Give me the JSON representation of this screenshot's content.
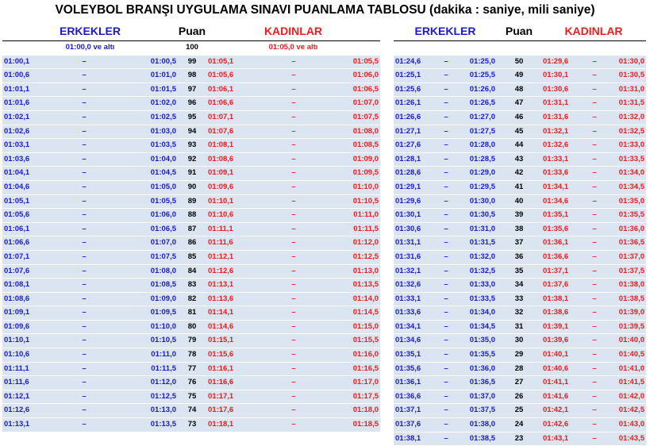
{
  "title": "VOLEYBOL BRANŞI UYGULAMA SINAVI PUANLAMA TABLOSU (dakika : saniye, mili saniye)",
  "headers": {
    "male": "ERKEKLER",
    "points": "Puan",
    "female": "KADINLAR"
  },
  "dash": "–",
  "colors": {
    "male": "#1a1ad6",
    "female": "#ee1c1c",
    "row_stripe": "#dbe5f1"
  },
  "base_row": {
    "male": "01:00,0 ve altı",
    "points": "100",
    "female": "01:05,0 ve altı"
  },
  "left_rows": [
    [
      "01:00,1",
      "01:00,5",
      "99",
      "01:05,1",
      "01:05,5"
    ],
    [
      "01:00,6",
      "01:01,0",
      "98",
      "01:05,6",
      "01:06,0"
    ],
    [
      "01:01,1",
      "01:01,5",
      "97",
      "01:06,1",
      "01:06,5"
    ],
    [
      "01:01,6",
      "01:02,0",
      "96",
      "01:06,6",
      "01:07,0"
    ],
    [
      "01:02,1",
      "01:02,5",
      "95",
      "01:07,1",
      "01:07,5"
    ],
    [
      "01:02,6",
      "01:03,0",
      "94",
      "01:07,6",
      "01:08,0"
    ],
    [
      "01:03,1",
      "01:03,5",
      "93",
      "01:08,1",
      "01:08,5"
    ],
    [
      "01:03,6",
      "01:04,0",
      "92",
      "01:08,6",
      "01:09,0"
    ],
    [
      "01:04,1",
      "01:04,5",
      "91",
      "01:09,1",
      "01:09,5"
    ],
    [
      "01:04,6",
      "01:05,0",
      "90",
      "01:09,6",
      "01:10,0"
    ],
    [
      "01:05,1",
      "01:05,5",
      "89",
      "01:10,1",
      "01:10,5"
    ],
    [
      "01:05,6",
      "01:06,0",
      "88",
      "01:10,6",
      "01:11,0"
    ],
    [
      "01:06,1",
      "01:06,5",
      "87",
      "01:11,1",
      "01:11,5"
    ],
    [
      "01:06,6",
      "01:07,0",
      "86",
      "01:11,6",
      "01:12,0"
    ],
    [
      "01:07,1",
      "01:07,5",
      "85",
      "01:12,1",
      "01:12,5"
    ],
    [
      "01:07,6",
      "01:08,0",
      "84",
      "01:12,6",
      "01:13,0"
    ],
    [
      "01:08,1",
      "01:08,5",
      "83",
      "01:13,1",
      "01:13,5"
    ],
    [
      "01:08,6",
      "01:09,0",
      "82",
      "01:13,6",
      "01:14,0"
    ],
    [
      "01:09,1",
      "01:09,5",
      "81",
      "01:14,1",
      "01:14,5"
    ],
    [
      "01:09,6",
      "01:10,0",
      "80",
      "01:14,6",
      "01:15,0"
    ],
    [
      "01:10,1",
      "01:10,5",
      "79",
      "01:15,1",
      "01:15,5"
    ],
    [
      "01:10,6",
      "01:11,0",
      "78",
      "01:15,6",
      "01:16,0"
    ],
    [
      "01:11,1",
      "01:11,5",
      "77",
      "01:16,1",
      "01:16,5"
    ],
    [
      "01:11,6",
      "01:12,0",
      "76",
      "01:16,6",
      "01:17,0"
    ],
    [
      "01:12,1",
      "01:12,5",
      "75",
      "01:17,1",
      "01:17,5"
    ],
    [
      "01:12,6",
      "01:13,0",
      "74",
      "01:17,6",
      "01:18,0"
    ],
    [
      "01:13,1",
      "01:13,5",
      "73",
      "01:18,1",
      "01:18,5"
    ]
  ],
  "right_rows": [
    [
      "01:24,6",
      "01:25,0",
      "50",
      "01:29,6",
      "01:30,0"
    ],
    [
      "01:25,1",
      "01:25,5",
      "49",
      "01:30,1",
      "01:30,5"
    ],
    [
      "01:25,6",
      "01:26,0",
      "48",
      "01:30,6",
      "01:31,0"
    ],
    [
      "01:26,1",
      "01:26,5",
      "47",
      "01:31,1",
      "01:31,5"
    ],
    [
      "01:26,6",
      "01:27,0",
      "46",
      "01:31,6",
      "01:32,0"
    ],
    [
      "01:27,1",
      "01:27,5",
      "45",
      "01:32,1",
      "01:32,5"
    ],
    [
      "01:27,6",
      "01:28,0",
      "44",
      "01:32,6",
      "01:33,0"
    ],
    [
      "01:28,1",
      "01:28,5",
      "43",
      "01:33,1",
      "01:33,5"
    ],
    [
      "01:28,6",
      "01:29,0",
      "42",
      "01:33,6",
      "01:34,0"
    ],
    [
      "01:29,1",
      "01:29,5",
      "41",
      "01:34,1",
      "01:34,5"
    ],
    [
      "01:29,6",
      "01:30,0",
      "40",
      "01:34,6",
      "01:35,0"
    ],
    [
      "01:30,1",
      "01:30,5",
      "39",
      "01:35,1",
      "01:35,5"
    ],
    [
      "01:30,6",
      "01:31,0",
      "38",
      "01:35,6",
      "01:36,0"
    ],
    [
      "01:31,1",
      "01:31,5",
      "37",
      "01:36,1",
      "01:36,5"
    ],
    [
      "01:31,6",
      "01:32,0",
      "36",
      "01:36,6",
      "01:37,0"
    ],
    [
      "01:32,1",
      "01:32,5",
      "35",
      "01:37,1",
      "01:37,5"
    ],
    [
      "01:32,6",
      "01:33,0",
      "34",
      "01:37,6",
      "01:38,0"
    ],
    [
      "01:33,1",
      "01:33,5",
      "33",
      "01:38,1",
      "01:38,5"
    ],
    [
      "01:33,6",
      "01:34,0",
      "32",
      "01:38,6",
      "01:39,0"
    ],
    [
      "01:34,1",
      "01:34,5",
      "31",
      "01:39,1",
      "01:39,5"
    ],
    [
      "01:34,6",
      "01:35,0",
      "30",
      "01:39,6",
      "01:40,0"
    ],
    [
      "01:35,1",
      "01:35,5",
      "29",
      "01:40,1",
      "01:40,5"
    ],
    [
      "01:35,6",
      "01:36,0",
      "28",
      "01:40,6",
      "01:41,0"
    ],
    [
      "01:36,1",
      "01:36,5",
      "27",
      "01:41,1",
      "01:41,5"
    ],
    [
      "01:36,6",
      "01:37,0",
      "26",
      "01:41,6",
      "01:42,0"
    ],
    [
      "01:37,1",
      "01:37,5",
      "25",
      "01:42,1",
      "01:42,5"
    ],
    [
      "01:37,6",
      "01:38,0",
      "24",
      "01:42,6",
      "01:43,0"
    ],
    [
      "01:38,1",
      "01:38,5",
      "23",
      "01:43,1",
      "01:43,5"
    ]
  ]
}
